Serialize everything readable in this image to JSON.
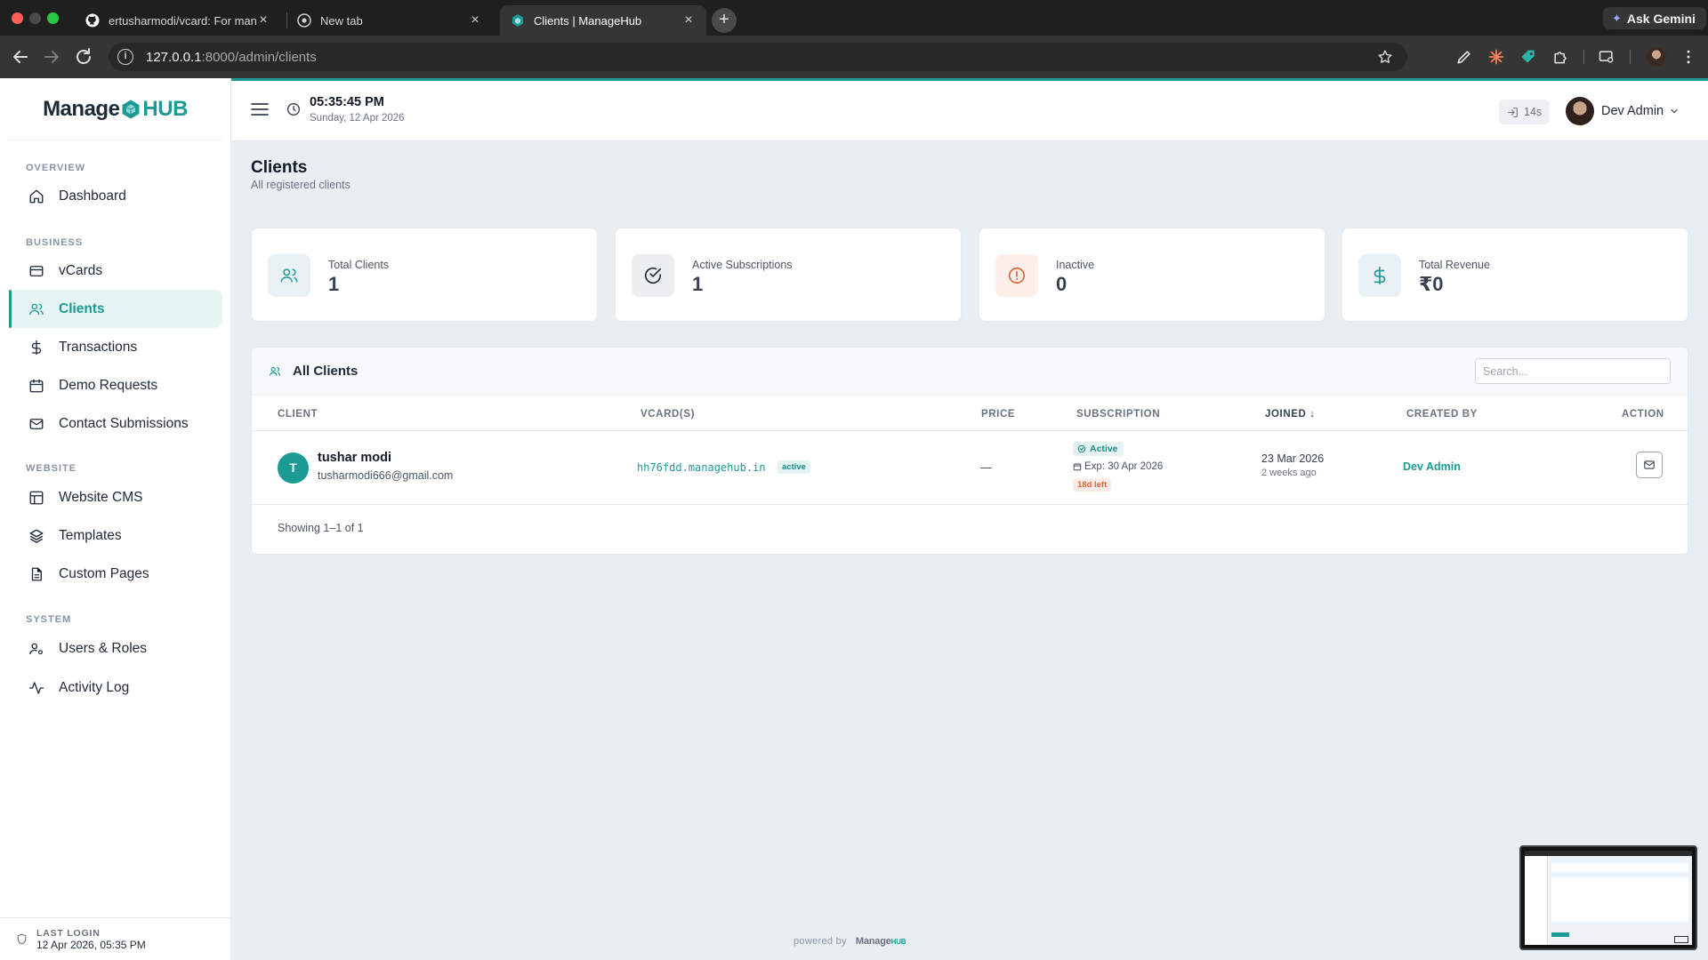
{
  "browser": {
    "tabs": [
      {
        "title": "ertusharmodi/vcard: For mana",
        "icon": "github-icon"
      },
      {
        "title": "New tab",
        "icon": "chrome-icon"
      },
      {
        "title": "Clients | ManageHub",
        "icon": "managehub-icon",
        "active": true
      }
    ],
    "ask_gemini": "Ask Gemini",
    "url_host": "127.0.0.1",
    "url_path": ":8000/admin/clients"
  },
  "app": {
    "logo": {
      "part1": "Manage",
      "part2": "HUB"
    },
    "sidebar": {
      "sections": [
        {
          "title": "OVERVIEW",
          "items": [
            {
              "label": "Dashboard",
              "icon": "home-icon"
            }
          ]
        },
        {
          "title": "BUSINESS",
          "items": [
            {
              "label": "vCards",
              "icon": "card-icon"
            },
            {
              "label": "Clients",
              "icon": "users-icon",
              "active": true
            },
            {
              "label": "Transactions",
              "icon": "dollar-icon"
            },
            {
              "label": "Demo Requests",
              "icon": "calendar-icon"
            },
            {
              "label": "Contact Submissions",
              "icon": "mail-icon"
            }
          ]
        },
        {
          "title": "WEBSITE",
          "items": [
            {
              "label": "Website CMS",
              "icon": "layout-icon"
            },
            {
              "label": "Templates",
              "icon": "layers-icon"
            },
            {
              "label": "Custom Pages",
              "icon": "file-icon"
            }
          ]
        },
        {
          "title": "SYSTEM",
          "items": [
            {
              "label": "Users & Roles",
              "icon": "user-cog-icon"
            },
            {
              "label": "Activity Log",
              "icon": "activity-icon"
            }
          ]
        }
      ],
      "last_login_label": "LAST LOGIN",
      "last_login_value": "12 Apr 2026, 05:35 PM"
    },
    "topbar": {
      "time": "05:35:45 PM",
      "date": "Sunday, 12 Apr 2026",
      "session": "14s",
      "user_name": "Dev Admin"
    },
    "page": {
      "title": "Clients",
      "subtitle": "All registered clients"
    },
    "stats": [
      {
        "label": "Total Clients",
        "value": "1",
        "icon": "users-icon",
        "color": "#1c9b95"
      },
      {
        "label": "Active Subscriptions",
        "value": "1",
        "icon": "check-circle-icon",
        "color": "#1e2a38"
      },
      {
        "label": "Inactive",
        "value": "0",
        "icon": "alert-circle-icon",
        "color": "#e0643b"
      },
      {
        "label": "Total Revenue",
        "value": "₹0",
        "icon": "dollar-icon",
        "color": "#1c9b95"
      }
    ],
    "table": {
      "title": "All Clients",
      "search_placeholder": "Search...",
      "columns": [
        "CLIENT",
        "VCARD(S)",
        "PRICE",
        "SUBSCRIPTION",
        "JOINED ↓",
        "CREATED BY",
        "ACTION"
      ],
      "rows": [
        {
          "initial": "T",
          "name": "tushar modi",
          "email": "tusharmodi666@gmail.com",
          "vcard": "hh76fdd.managehub.in",
          "vcard_status": "active",
          "price": "—",
          "subscription_status": "Active",
          "expiry": "Exp: 30 Apr 2026",
          "days_left": "18d left",
          "joined": "23 Mar 2026",
          "joined_relative": "2 weeks ago",
          "created_by": "Dev Admin"
        }
      ],
      "pagination": "Showing 1–1 of 1"
    },
    "footer": {
      "text": "powered by",
      "logo_part1": "Manage",
      "logo_part2": "HUB"
    }
  }
}
